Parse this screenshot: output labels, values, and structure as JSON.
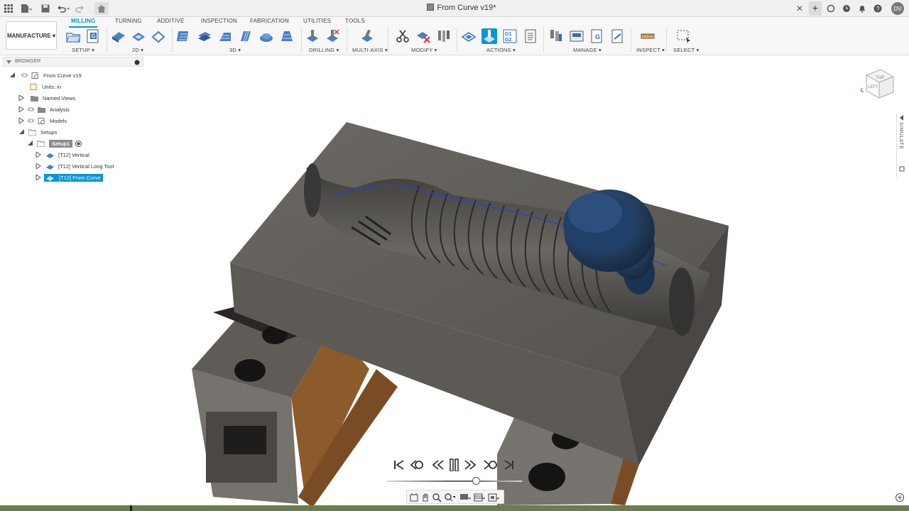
{
  "window": {
    "title": "From Curve v19*",
    "user_initials": "DV",
    "icons": [
      "grid-icon",
      "file-icon",
      "save-icon",
      "undo-icon",
      "redo-icon",
      "home-icon",
      "close-icon",
      "plus-icon",
      "refresh-icon",
      "clock-icon",
      "bell-icon",
      "help-icon"
    ]
  },
  "ribbon": {
    "workspace": "MANUFACTURE",
    "tabs": [
      {
        "label": "MILLING",
        "active": true
      },
      {
        "label": "TURNING"
      },
      {
        "label": "ADDITIVE"
      },
      {
        "label": "INSPECTION"
      },
      {
        "label": "FABRICATION"
      },
      {
        "label": "UTILITIES"
      },
      {
        "label": "TOOLS"
      }
    ],
    "groups": {
      "setup": "SETUP",
      "twod": "2D",
      "threed": "3D",
      "drilling": "DRILLING",
      "multiaxis": "MULTI-AXIS",
      "modify": "MODIFY",
      "actions": "ACTIONS",
      "manage": "MANAGE",
      "inspect": "INSPECT",
      "select": "SELECT"
    },
    "nc_badge": "G",
    "gcode_badge": "G1 G2",
    "accent": "#0696d7"
  },
  "browser": {
    "title": "BROWSER",
    "items": [
      {
        "label": "From Curve v19"
      },
      {
        "label": "Units: in"
      },
      {
        "label": "Named Views"
      },
      {
        "label": "Analysis"
      },
      {
        "label": "Models"
      },
      {
        "label": "Setups"
      },
      {
        "label": "Setup1"
      },
      {
        "label": "[T12] Vertical"
      },
      {
        "label": "[T12] Vertical Long Tool"
      },
      {
        "label": "[T12] From Curve",
        "selected": true
      }
    ]
  },
  "viewcube": {
    "faces": [
      "TOP",
      "LEFT"
    ]
  },
  "side_panel": {
    "label": "SIMULATE"
  },
  "simulation": {
    "controls": [
      "skip-to-start-icon",
      "step-back-icon",
      "rewind-icon",
      "pause-icon",
      "fast-forward-icon",
      "step-forward-icon",
      "skip-to-end-icon"
    ],
    "progress": 0.66
  },
  "colors": {
    "status_bar": "#6b7d4a",
    "part": "#5a5652",
    "tool": "#1f3a5c"
  }
}
